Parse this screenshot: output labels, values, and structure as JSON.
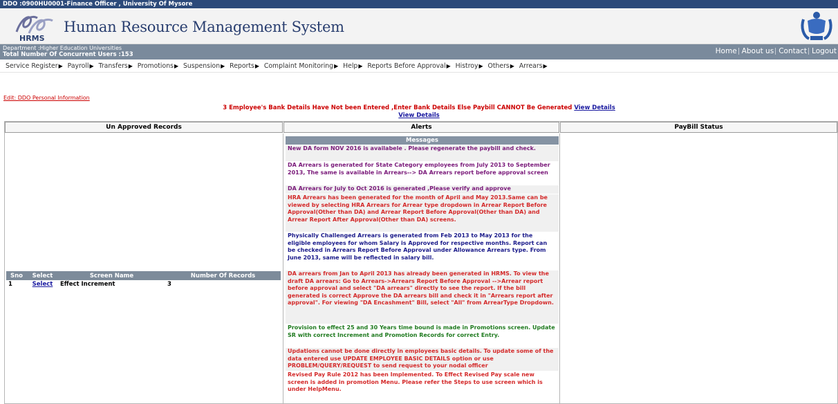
{
  "window": {
    "title": "DDO :0900HU0001-Finance Officer , University Of Mysore"
  },
  "banner": {
    "logo_text": "HRMS",
    "system_name": "Human Resource Management System"
  },
  "dept": {
    "department": "Department :Higher Education Universities",
    "concurrent_users": "Total Number Of Concurrent Users :153"
  },
  "toplinks": {
    "home": "Home",
    "about": "About us",
    "contact": "Contact",
    "logout": "Logout"
  },
  "menu": [
    "Service Register",
    "Payroll",
    "Transfers",
    "Promotions",
    "Suspension",
    "Reports",
    "Complaint Monitoring",
    "Help",
    "Reports Before Approval",
    "Histroy",
    "Others",
    "Arrears"
  ],
  "edit_link": "Edit: DDO Personal Information",
  "warning": {
    "text": "3 Employee's Bank Details Have Not been Entered ,Enter Bank Details Else Paybill CANNOT Be Generated",
    "link1": "View Details",
    "link2": "View Details"
  },
  "panels": {
    "unapproved": "Un Approved Records",
    "alerts": "Alerts",
    "paybill": "PayBill Status"
  },
  "records": {
    "headers": [
      "Sno",
      "Select",
      "Screen Name",
      "Number Of Records"
    ],
    "rows": [
      {
        "sno": "1",
        "select": "Select",
        "screen": "Effect Increment",
        "count": "3"
      }
    ]
  },
  "messages": {
    "header": "Messages",
    "items": [
      "New DA form NOV 2016 is availabele . Please regenerate the paybill and check.",
      "DA Arrears is generated for State Category employees from July 2013 to September 2013, The same is available in Arrears--> DA Arrears report before approval screen",
      "DA Arrears for July to Oct 2016 is generated ,Please verify and approve",
      "HRA Arrears has been generated for the month of April and May 2013.Same can be viewed by selecting HRA Arrears for Arrear type dropdown in Arrear Report Before Approval(Other than DA) and Arrear Report Before Approval(Other than DA) and Arrear Report After Approval(Other than DA) screens.",
      "Physically Challenged Arrears is generated from Feb 2013 to May 2013 for the eligible employees for whom Salary is Approved for respective months. Report can be checked in Arrears Report Before Approval under Allowance Arrears type. From June 2013, same will be reflected in salary bill.",
      "DA arrears from Jan to April 2013 has already been generated in HRMS. To view the draft DA arrears: Go to Arrears->Arrears Report Before Approval -->Arrear report before approval and select \"DA arrears\" directly to see the report. If the bill generated is correct Approve the DA arrears bill and check it in \"Arrears report after approval\". For viewing \"DA Encashment\" Bill, select \"All\" from ArrearType Dropdown.",
      "Provision to effect 25 and 30 Years time bound is made in Promotions screen. Update SR with correct Increment and Promotion Records for correct Entry.",
      "Updations cannot be done directly in employees basic details. To update some of the data entered use UPDATE EMPLOYEE BASIC DETAILS option or use PROBLEM/QUERY/REQUEST to send request to your nodal officer",
      "Revised Pay Rule 2012 has been Implemented. To Effect Revised Pay scale new screen is added in promotion Menu. Please refer the Steps to use screen which is under HelpMenu."
    ],
    "colors": {
      "purple": "#7a1a7a",
      "red": "#d42a2a",
      "blue": "#1a1a8a",
      "green": "#1f7a1f"
    }
  }
}
